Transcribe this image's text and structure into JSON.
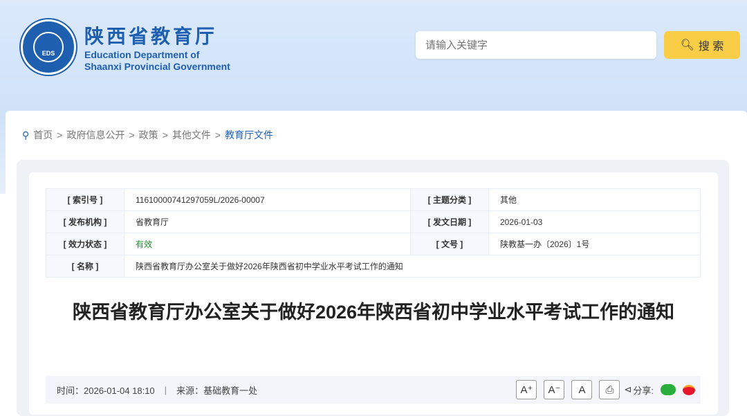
{
  "header": {
    "title_cn": "陕西省教育厅",
    "title_en_1": "Education Department of",
    "title_en_2": "Shaanxi Provincial Government",
    "seal_text": "EDS",
    "search_placeholder": "请输入关键字",
    "search_label": "搜 索"
  },
  "breadcrumb": [
    "首页",
    "政府信息公开",
    "政策",
    "其他文件",
    "教育厅文件"
  ],
  "info": {
    "index_label": "[ 索引号 ]",
    "index": "11610000741297059L/2026-00007",
    "topic_label": "[ 主题分类 ]",
    "topic": "其他",
    "org_label": "[ 发布机构 ]",
    "org": "省教育厅",
    "date_label": "[ 发文日期 ]",
    "date": "2026-01-03",
    "status_label": "[ 效力状态 ]",
    "status": "有效",
    "docno_label": "[ 文号 ]",
    "docno": "陕教基一办〔2026〕1号",
    "name_label": "[ 名称 ]",
    "name": "陕西省教育厅办公室关于做好2026年陕西省初中学业水平考试工作的通知"
  },
  "article": {
    "title": "陕西省教育厅办公室关于做好2026年陕西省初中学业水平考试工作的通知",
    "time_label": "时间：",
    "time": "2026-01-04 18:10",
    "sep": "|",
    "source_label": "来源：",
    "source": "基础教育一处",
    "font_up": "A⁺",
    "font_down": "A⁻",
    "font_reset": "A",
    "share_label": "分享:"
  }
}
